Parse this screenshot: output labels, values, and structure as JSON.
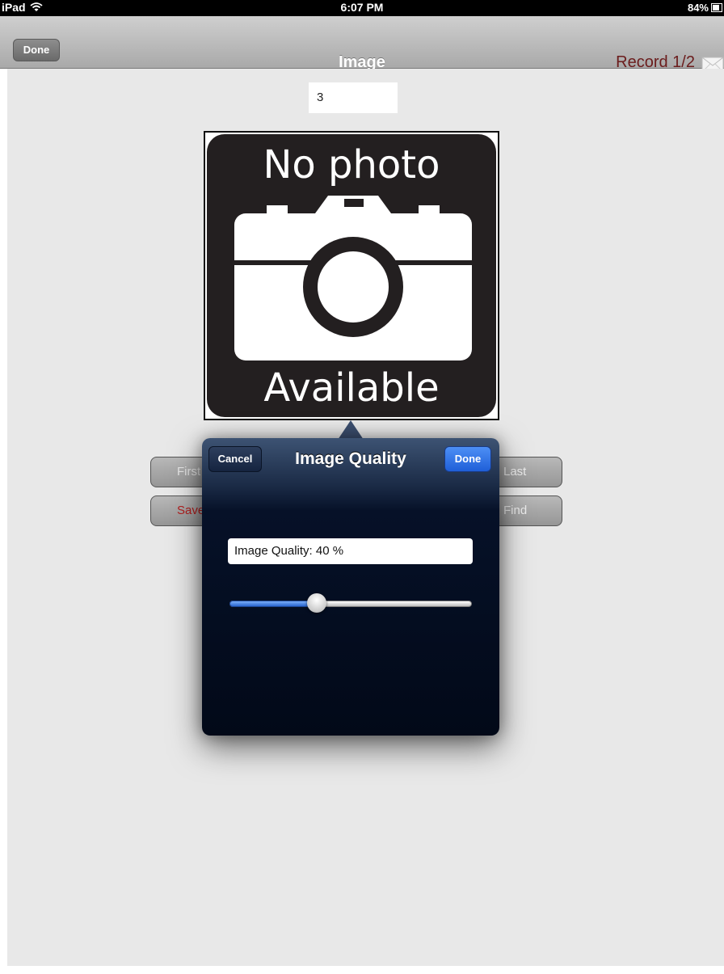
{
  "status_bar": {
    "device": "iPad",
    "time": "6:07 PM",
    "battery": "84%"
  },
  "nav": {
    "done_label": "Done",
    "title": "Image",
    "record": "Record 1/2",
    "mail_icon": "mail-icon"
  },
  "form": {
    "number_value": "3"
  },
  "photo": {
    "top_text": "No photo",
    "bottom_text": "Available"
  },
  "buttons": {
    "first": "First",
    "save": "Save",
    "last": "Last",
    "find": "Find"
  },
  "popover": {
    "cancel_label": "Cancel",
    "title": "Image Quality",
    "done_label": "Done",
    "quality_text": "Image Quality: 40 %",
    "slider_value": 0.36
  },
  "colors": {
    "accent_blue": "#2a66d0",
    "record_text": "#6b1c1c",
    "save_text": "#b21e1e"
  }
}
